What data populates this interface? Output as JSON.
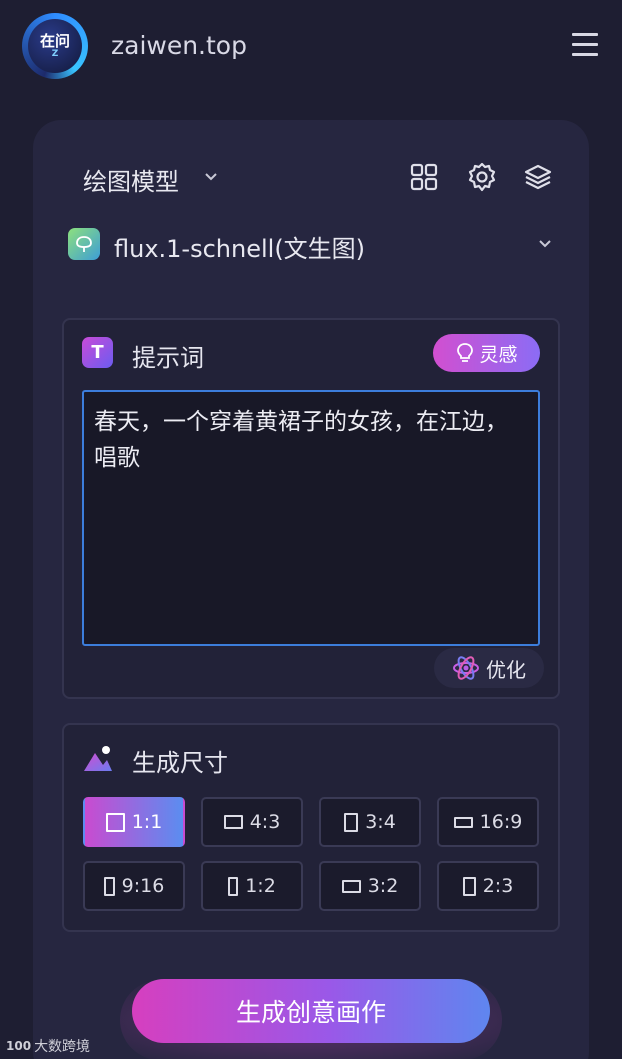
{
  "header": {
    "logo_text": "在问",
    "logo_sub": "Z",
    "site_name": "zaiwen.top"
  },
  "model": {
    "section_label": "绘图模型",
    "selected": "flux.1-schnell(文生图)"
  },
  "prompt": {
    "title": "提示词",
    "title_icon_letter": "T",
    "inspire_label": "灵感",
    "text": "春天，一个穿着黄裙子的女孩，在江边，唱歌",
    "optimize_label": "优化"
  },
  "size": {
    "title": "生成尺寸",
    "ratios": [
      "1:1",
      "4:3",
      "3:4",
      "16:9",
      "9:16",
      "1:2",
      "3:2",
      "2:3"
    ],
    "selected": "1:1"
  },
  "generate_label": "生成创意画作",
  "watermark": {
    "logo": "100",
    "text": "大数跨境"
  },
  "colors": {
    "background": "#1e1e32",
    "card": "#262640",
    "accent_pink": "#d24fd0",
    "accent_blue": "#5b8df0",
    "input_border": "#3c7ddb"
  }
}
